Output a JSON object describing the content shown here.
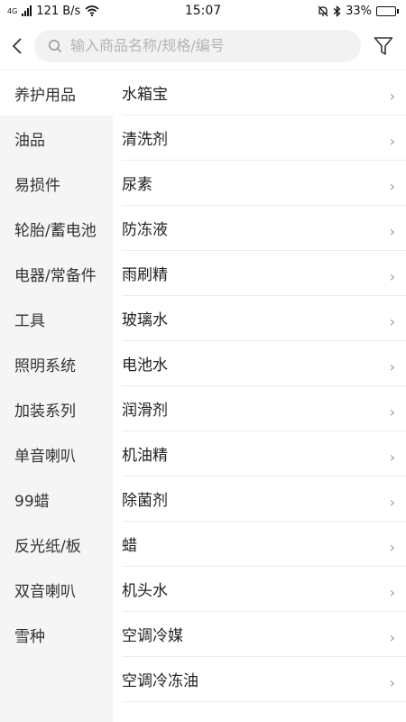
{
  "status": {
    "network": "4G",
    "speed": "121 B/s",
    "time": "15:07",
    "battery_text": "33%",
    "battery_level": 0.33
  },
  "header": {
    "back_icon": "chevron-left-icon",
    "search_icon": "search-icon",
    "search_placeholder": "输入商品名称/规格/编号",
    "search_value": "",
    "filter_icon": "filter-funnel-icon"
  },
  "sidebar": {
    "selected_index": 0,
    "items": [
      {
        "label": "养护用品"
      },
      {
        "label": "油品"
      },
      {
        "label": "易损件"
      },
      {
        "label": "轮胎/蓄电池"
      },
      {
        "label": "电器/常备件"
      },
      {
        "label": "工具"
      },
      {
        "label": "照明系统"
      },
      {
        "label": "加装系列"
      },
      {
        "label": "单音喇叭"
      },
      {
        "label": "99蜡"
      },
      {
        "label": "反光纸/板"
      },
      {
        "label": "双音喇叭"
      },
      {
        "label": "雪种"
      }
    ]
  },
  "content": {
    "chevron": "›",
    "items": [
      {
        "label": "水箱宝"
      },
      {
        "label": "清洗剂"
      },
      {
        "label": "尿素"
      },
      {
        "label": "防冻液"
      },
      {
        "label": "雨刷精"
      },
      {
        "label": "玻璃水"
      },
      {
        "label": "电池水"
      },
      {
        "label": "润滑剂"
      },
      {
        "label": "机油精"
      },
      {
        "label": "除菌剂"
      },
      {
        "label": "蜡"
      },
      {
        "label": "机头水"
      },
      {
        "label": "空调冷媒"
      },
      {
        "label": "空调冷冻油"
      }
    ]
  },
  "colors": {
    "sidebar_bg": "#f5f5f5",
    "search_bg": "#f2f2f2",
    "divider": "#ececec"
  }
}
